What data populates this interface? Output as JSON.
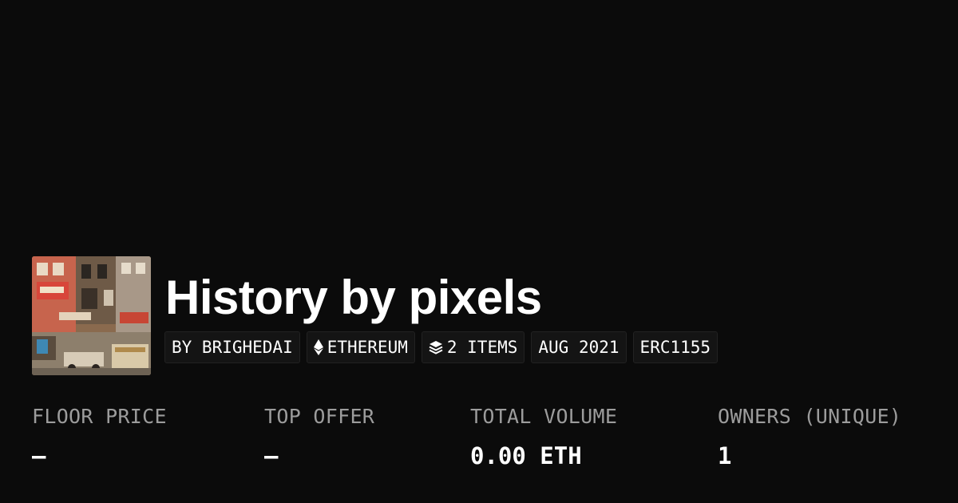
{
  "collection": {
    "name": "History by pixels",
    "thumbnail_icon": "collection-artwork-image"
  },
  "badges": {
    "creator": "BY BRIGHEDAI",
    "chain": {
      "icon": "ethereum-icon",
      "label": "ETHEREUM"
    },
    "items": {
      "icon": "layers-icon",
      "label": "2 ITEMS"
    },
    "date": "AUG 2021",
    "standard": "ERC1155"
  },
  "stats": {
    "floor_price": {
      "label": "FLOOR PRICE",
      "value": "–"
    },
    "top_offer": {
      "label": "TOP OFFER",
      "value": "–"
    },
    "total_volume": {
      "label": "TOTAL VOLUME",
      "value": "0.00 ETH"
    },
    "owners": {
      "label": "OWNERS (UNIQUE)",
      "value": "1"
    }
  },
  "colors": {
    "background": "#0b0b0b",
    "text": "#ffffff",
    "muted_text": "#9c9c9c",
    "badge_background": "#141414"
  }
}
